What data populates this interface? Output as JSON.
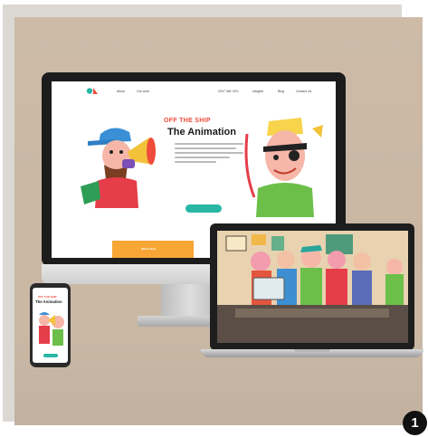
{
  "site": {
    "nav": [
      "About",
      "Our work",
      "0207 484 XXX",
      "Insights",
      "Blog",
      "Contact Us"
    ],
    "hero_kicker": "OFF THE SHIP",
    "hero_title": "The Animation",
    "cards": [
      "Watch Now",
      ""
    ]
  },
  "phone": {
    "kicker": "OFF THE SHIP",
    "title": "The Animation"
  },
  "badge": {
    "number": "1"
  },
  "colors": {
    "accent_red": "#ef4b3a",
    "accent_teal": "#29b6a5",
    "accent_orange": "#f7a535",
    "background": "#cdbba8"
  }
}
